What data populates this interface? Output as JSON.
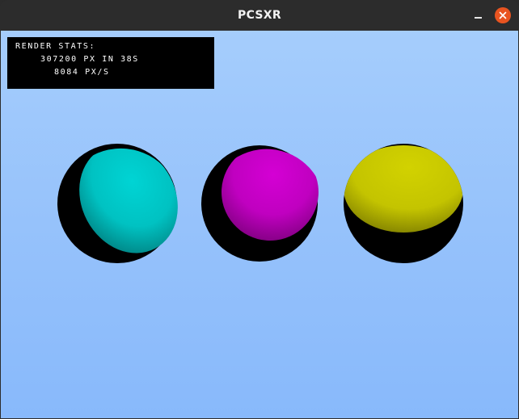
{
  "window": {
    "title": "PCSXR",
    "controls": {
      "minimize_icon": "minimize-icon",
      "close_icon": "close-icon",
      "close_color": "#e95420"
    }
  },
  "render_stats": {
    "heading": "RENDER STATS:",
    "line1": "307200 PX IN 38S",
    "line2": "8084 PX/S"
  },
  "scene": {
    "background_top": "#a5cdfc",
    "background_bottom": "#88b9fb",
    "spheres": [
      {
        "name": "cyan-sphere",
        "color": "#00d0d0"
      },
      {
        "name": "magenta-sphere",
        "color": "#d000d0"
      },
      {
        "name": "yellow-sphere",
        "color": "#d0d000"
      }
    ]
  }
}
